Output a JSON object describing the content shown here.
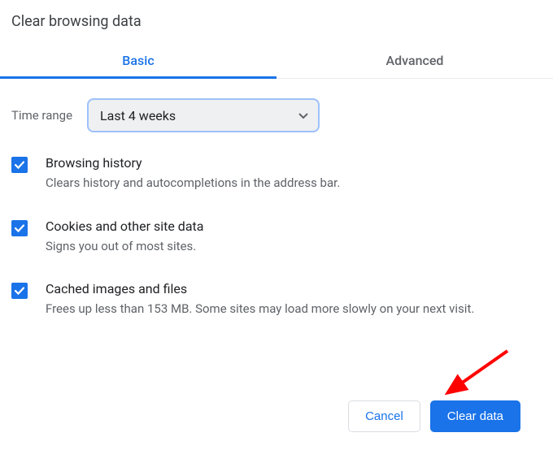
{
  "title": "Clear browsing data",
  "tabs": {
    "basic": "Basic",
    "advanced": "Advanced"
  },
  "timeRange": {
    "label": "Time range",
    "value": "Last 4 weeks"
  },
  "options": [
    {
      "title": "Browsing history",
      "description": "Clears history and autocompletions in the address bar."
    },
    {
      "title": "Cookies and other site data",
      "description": "Signs you out of most sites."
    },
    {
      "title": "Cached images and files",
      "description": "Frees up less than 153 MB. Some sites may load more slowly on your next visit."
    }
  ],
  "buttons": {
    "cancel": "Cancel",
    "clear": "Clear data"
  }
}
